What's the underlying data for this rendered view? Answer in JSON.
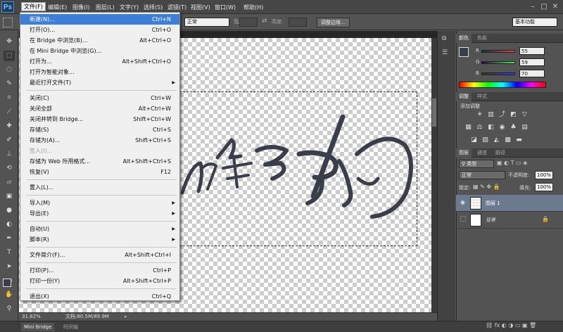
{
  "app": {
    "logo": "Ps"
  },
  "menubar": {
    "items": [
      {
        "label": "文件(F)"
      },
      {
        "label": "编辑(E)"
      },
      {
        "label": "图像(I)"
      },
      {
        "label": "图层(L)"
      },
      {
        "label": "文字(Y)"
      },
      {
        "label": "选择(S)"
      },
      {
        "label": "滤镜(T)"
      },
      {
        "label": "视图(V)"
      },
      {
        "label": "窗口(W)"
      },
      {
        "label": "帮助(H)"
      }
    ]
  },
  "options_bar": {
    "style_select": "正常",
    "width_label": "宽度:",
    "height_label": "高度:",
    "refine_edge": "调整边缘...",
    "workspace": "基本功能"
  },
  "file_menu": {
    "items": [
      {
        "label": "新建(N)...",
        "shortcut": "Ctrl+N",
        "highlighted": true
      },
      {
        "label": "打开(O)...",
        "shortcut": "Ctrl+O"
      },
      {
        "label": "在 Bridge 中浏览(B)...",
        "shortcut": "Alt+Ctrl+O"
      },
      {
        "label": "在 Mini Bridge 中浏览(G)...",
        "shortcut": ""
      },
      {
        "label": "打开为...",
        "shortcut": "Alt+Shift+Ctrl+O"
      },
      {
        "label": "打开为智能对象...",
        "shortcut": ""
      },
      {
        "label": "最近打开文件(T)",
        "shortcut": "",
        "submenu": true
      },
      {
        "sep": true
      },
      {
        "label": "关闭(C)",
        "shortcut": "Ctrl+W"
      },
      {
        "label": "关闭全部",
        "shortcut": "Alt+Ctrl+W"
      },
      {
        "label": "关闭并转到 Bridge...",
        "shortcut": "Shift+Ctrl+W"
      },
      {
        "label": "存储(S)",
        "shortcut": "Ctrl+S"
      },
      {
        "label": "存储为(A)...",
        "shortcut": "Shift+Ctrl+S"
      },
      {
        "label": "签入(I)...",
        "shortcut": "",
        "disabled": true
      },
      {
        "label": "存储为 Web 所用格式...",
        "shortcut": "Alt+Shift+Ctrl+S"
      },
      {
        "label": "恢复(V)",
        "shortcut": "F12"
      },
      {
        "sep": true
      },
      {
        "label": "置入(L)...",
        "shortcut": ""
      },
      {
        "sep": true
      },
      {
        "label": "导入(M)",
        "shortcut": "",
        "submenu": true
      },
      {
        "label": "导出(E)",
        "shortcut": "",
        "submenu": true
      },
      {
        "sep": true
      },
      {
        "label": "自动(U)",
        "shortcut": "",
        "submenu": true
      },
      {
        "label": "脚本(R)",
        "shortcut": "",
        "submenu": true
      },
      {
        "sep": true
      },
      {
        "label": "文件简介(F)...",
        "shortcut": "Alt+Shift+Ctrl+I"
      },
      {
        "sep": true
      },
      {
        "label": "打印(P)...",
        "shortcut": "Ctrl+P"
      },
      {
        "label": "打印一份(Y)",
        "shortcut": "Alt+Shift+Ctrl+P"
      },
      {
        "sep": true
      },
      {
        "label": "退出(X)",
        "shortcut": "Ctrl+Q"
      }
    ]
  },
  "status": {
    "zoom": "31.82%",
    "doc": "文档:80.5M/89.9M"
  },
  "bottom_tabs": [
    {
      "label": "Mini Bridge"
    },
    {
      "label": "时间轴"
    }
  ],
  "color_panel": {
    "tabs": [
      "颜色",
      "色板"
    ],
    "r_label": "R",
    "g_label": "G",
    "b_label": "B",
    "r": "55",
    "g": "59",
    "b": "70"
  },
  "adjust_panel": {
    "tabs": [
      "调整",
      "样式"
    ],
    "title": "添加调整"
  },
  "layers_panel": {
    "tabs": [
      "图层",
      "通道",
      "路径"
    ],
    "kind": "类型",
    "blend": "正常",
    "opacity_label": "不透明度:",
    "opacity": "100%",
    "lock_label": "锁定:",
    "fill_label": "填充:",
    "fill": "100%",
    "layers": [
      {
        "name": "图层 1",
        "selected": true
      },
      {
        "name": "背景",
        "selected": false
      }
    ]
  },
  "colors": {
    "accent": "#3d7fd6",
    "ink": "#3a3e4a"
  }
}
